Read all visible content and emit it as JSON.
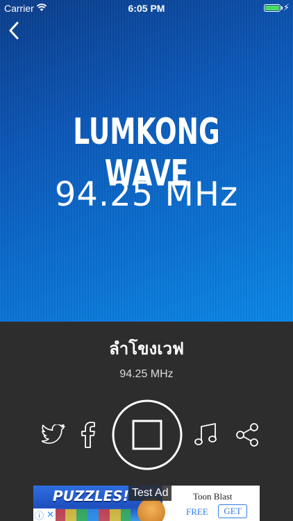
{
  "status_bar": {
    "carrier": "Carrier",
    "time": "6:05 PM",
    "battery_level": 1.0
  },
  "hero": {
    "title": "LUMKONG WAVE",
    "frequency": "94.25 MHz",
    "gradient_colors": [
      "#0a3c8a",
      "#0a86e6"
    ]
  },
  "player": {
    "station_name": "ลำโขงเวฟ",
    "station_frequency": "94.25 MHz",
    "state": "playing",
    "controls": [
      {
        "name": "twitter",
        "icon": "twitter-icon"
      },
      {
        "name": "facebook",
        "icon": "facebook-icon"
      },
      {
        "name": "stop",
        "icon": "stop-icon"
      },
      {
        "name": "music",
        "icon": "music-note-icon"
      },
      {
        "name": "share",
        "icon": "share-icon"
      }
    ]
  },
  "ad": {
    "headline": "PUZZLES!",
    "label": "Test Ad",
    "app_name": "Toon Blast",
    "price": "FREE",
    "cta": "GET"
  },
  "colors": {
    "player_background": "#2d2d2d",
    "ad_accent": "#2f7ce6"
  }
}
